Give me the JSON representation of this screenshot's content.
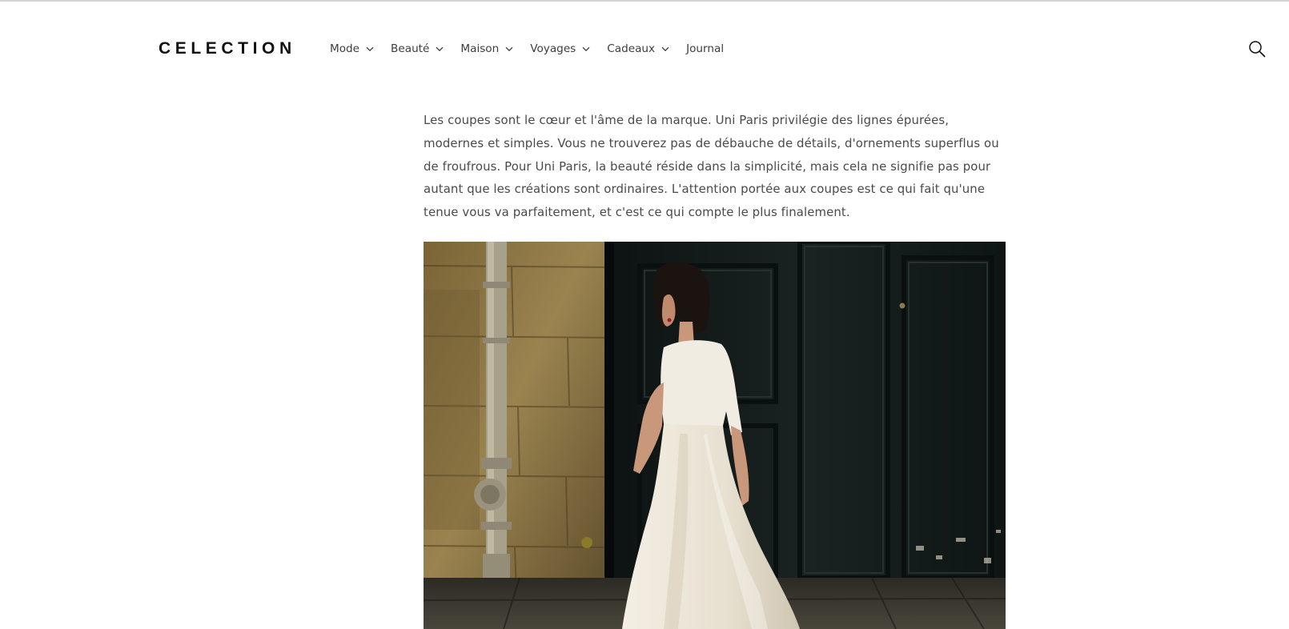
{
  "header": {
    "logo": "CELECTION",
    "nav": [
      {
        "label": "Mode",
        "has_dropdown": true
      },
      {
        "label": "Beauté",
        "has_dropdown": true
      },
      {
        "label": "Maison",
        "has_dropdown": true
      },
      {
        "label": "Voyages",
        "has_dropdown": true
      },
      {
        "label": "Cadeaux",
        "has_dropdown": true
      },
      {
        "label": "Journal",
        "has_dropdown": false
      }
    ],
    "search_icon": "search-icon"
  },
  "article": {
    "paragraph": "Les coupes sont le cœur et l'âme de la marque. Uni Paris privilégie des lignes épurées, modernes et simples. Vous ne trouverez pas de débauche de détails, d'ornements superflus ou de froufrous. Pour Uni Paris, la beauté réside dans la simplicité, mais cela ne signifie pas pour autant que les créations sont ordinaires. L'attention portée aux coupes est ce qui fait qu'une tenue vous va parfaitement, et c'est ce qui compte le plus finalement."
  },
  "colors": {
    "text": "#121212",
    "body_text": "#4a4a4a",
    "nav_text": "#3d3d3d",
    "topline": "#d4d4d4",
    "door": "#121a19",
    "wall": "#8a7546",
    "dress": "#efe9dc"
  }
}
